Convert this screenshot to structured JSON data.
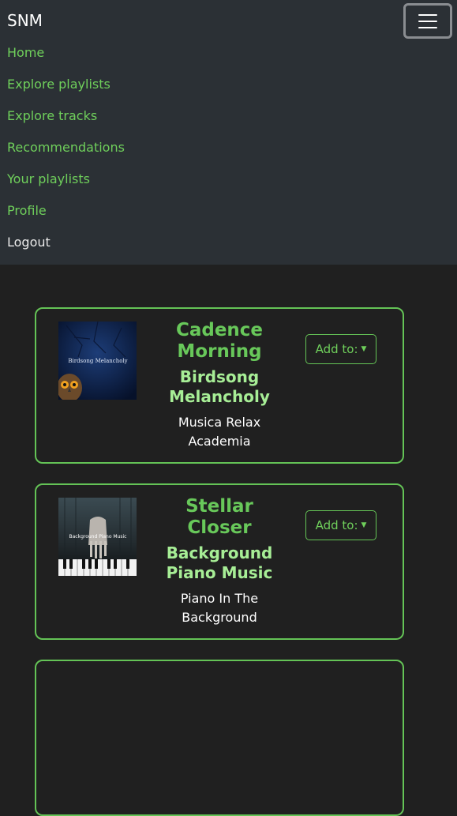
{
  "navbar": {
    "brand": "SNM",
    "toggler_icon": "hamburger-menu-icon",
    "links": [
      "Home",
      "Explore playlists",
      "Explore tracks",
      "Recommendations",
      "Your playlists",
      "Profile"
    ],
    "logout": "Logout"
  },
  "colors": {
    "accent": "#64c356",
    "navbar_bg": "#2b3035",
    "page_bg": "#202020"
  },
  "tracks": [
    {
      "title": "Cadence Morning",
      "album": "Birdsong Melancholy",
      "artist": "Musica Relax Academia",
      "cover_text": "Birdsong Melancholy",
      "add_label": "Add to:"
    },
    {
      "title": "Stellar Closer",
      "album": "Background Piano Music",
      "artist": "Piano In The Background",
      "cover_text": "Background Piano Music",
      "add_label": "Add to:"
    }
  ]
}
